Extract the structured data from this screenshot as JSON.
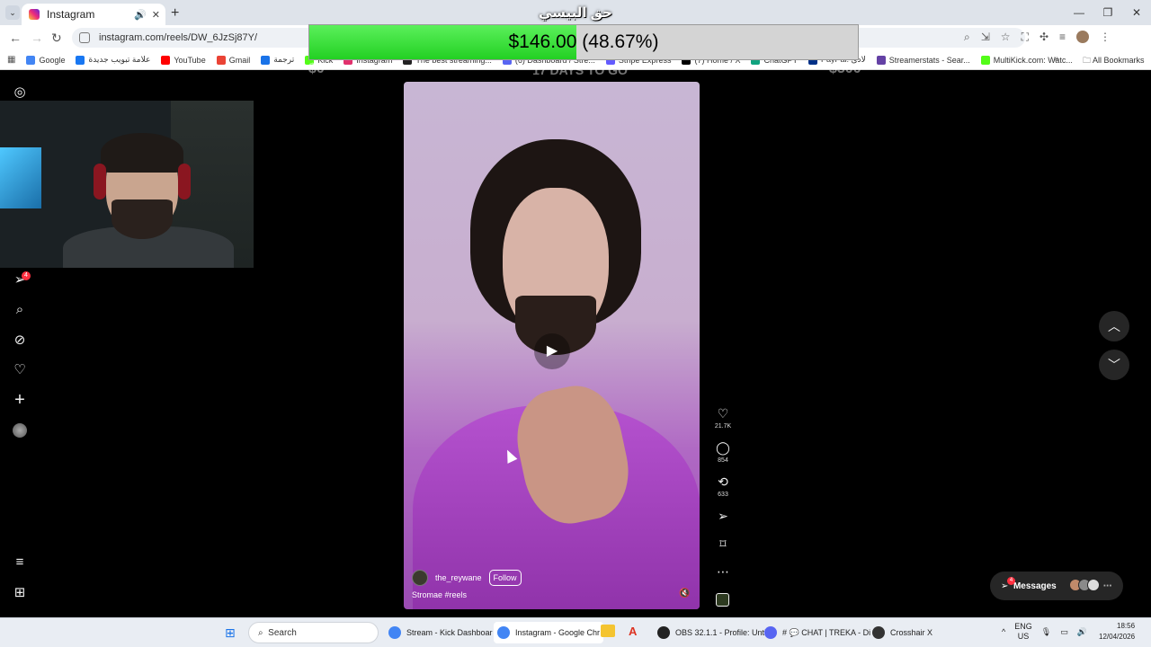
{
  "browser": {
    "tab_title": "Instagram",
    "url": "instagram.com/reels/DW_6JzSj87Y/",
    "bookmarks": [
      "Google",
      "علامة تبويب جديدة",
      "YouTube",
      "Gmail",
      "ترجمة",
      "Kick",
      "Instagram",
      "The best streaming...",
      "(6) Dashboard / Stre...",
      "Stripe Express",
      "(7) Home / X",
      "ChatGPT",
      "PayPal: لادئ",
      "Streamerstats - Sear...",
      "MultiKick.com: Watc..."
    ],
    "all_bookmarks": "All Bookmarks",
    "bookmark_colors": [
      "#4285f4",
      "#1877f2",
      "#ff0000",
      "#ea4335",
      "#1a73e8",
      "#53fc18",
      "#e1306c",
      "#222222",
      "#5865f2",
      "#635bff",
      "#000000",
      "#10a37f",
      "#003087",
      "#6441a5",
      "#53fc18"
    ]
  },
  "overlay": {
    "title": "حق البيسي",
    "amount_text": "$146.00",
    "percent_text": "(48.67%)",
    "progress": 0.4867,
    "min_label": "$0",
    "max_label": "$300",
    "days_label": "17 DAYS TO GO"
  },
  "instagram": {
    "sidebar_icons": [
      "instagram-icon",
      "direct-icon",
      "search-icon",
      "explore-icon",
      "heart-icon",
      "create-icon",
      "profile-icon",
      "menu-icon",
      "also-from-meta-icon"
    ],
    "notif_count": "4",
    "reel": {
      "username": "the_reywane",
      "follow_label": "Follow",
      "caption": "Stromae #reels",
      "likes": "21.7K",
      "comments": "854",
      "reposts": "633"
    },
    "messages_label": "Messages",
    "messages_badge": "4"
  },
  "taskbar": {
    "search_label": "Search",
    "apps": [
      {
        "label": "Stream - Kick Dashboar",
        "active": false
      },
      {
        "label": "Instagram - Google Chr",
        "active": true
      },
      {
        "label": "OBS 32.1.1 - Profile: Unti",
        "active": false
      },
      {
        "label": "# 💬 CHAT | TREKA - Di",
        "active": false
      },
      {
        "label": "Crosshair X",
        "active": false
      }
    ],
    "lang_top": "ENG",
    "lang_bottom": "US",
    "time": "18:56",
    "date": "12/04/2026"
  }
}
